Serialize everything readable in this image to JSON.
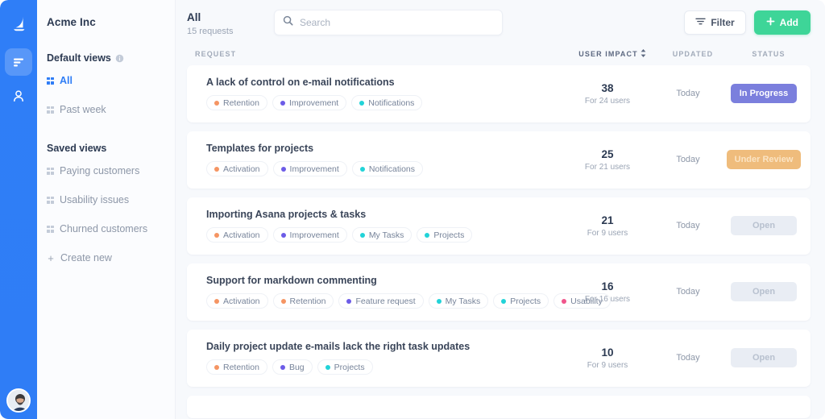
{
  "rail": {
    "logo_icon": "sail-logo-icon",
    "items": [
      {
        "icon": "feedback-bars-icon",
        "name": "rail-item-feedback",
        "active": true
      },
      {
        "icon": "user-icon",
        "name": "rail-item-users",
        "active": false
      }
    ],
    "avatar_icon": "user-avatar",
    "accent": "#2f7df6"
  },
  "sidebar": {
    "org_name": "Acme Inc",
    "groups": [
      {
        "title": "Default views",
        "has_info_icon": true,
        "items": [
          {
            "label": "All",
            "icon": "grid-icon",
            "active": true
          },
          {
            "label": "Past week",
            "icon": "grid-icon",
            "active": false
          }
        ]
      },
      {
        "title": "Saved views",
        "has_info_icon": false,
        "items": [
          {
            "label": "Paying customers",
            "icon": "grid-icon",
            "active": false
          },
          {
            "label": "Usability issues",
            "icon": "grid-icon",
            "active": false
          },
          {
            "label": "Churned customers",
            "icon": "grid-icon",
            "active": false
          },
          {
            "label": "Create new",
            "icon": "plus-icon",
            "active": false
          }
        ]
      }
    ]
  },
  "header": {
    "view_title": "All",
    "view_count": "15 requests",
    "search": {
      "placeholder": "Search",
      "value": "",
      "icon": "search-icon"
    },
    "filter_label": "Filter",
    "add_label": "Add",
    "add_color": "#3ed598"
  },
  "table": {
    "columns": {
      "request": "REQUEST",
      "user_impact": "USER IMPACT",
      "sort_icon": "sort-arrows-icon",
      "updated": "UPDATED",
      "status": "STATUS"
    },
    "tag_colors": {
      "Retention": "#f59563",
      "Activation": "#f59563",
      "Improvement": "#6c5ce7",
      "Feature request": "#6c5ce7",
      "Bug": "#6c5ce7",
      "Notifications": "#22d3d8",
      "My Tasks": "#22d3d8",
      "Projects": "#22d3d8",
      "Usability": "#f0558c"
    },
    "status_colors": {
      "In Progress": "#7b7fdd",
      "Under Review": "#efbc7c",
      "Open": "#e9edf4"
    },
    "rows": [
      {
        "title": "A lack of control on e-mail notifications",
        "tags": [
          "Retention",
          "Improvement",
          "Notifications"
        ],
        "impact": "38",
        "impact_sub": "For 24 users",
        "updated": "Today",
        "status": "In Progress",
        "status_class": "in-progress"
      },
      {
        "title": "Templates for projects",
        "tags": [
          "Activation",
          "Improvement",
          "Notifications"
        ],
        "impact": "25",
        "impact_sub": "For 21 users",
        "updated": "Today",
        "status": "Under Review",
        "status_class": "under-review"
      },
      {
        "title": "Importing Asana projects & tasks",
        "tags": [
          "Activation",
          "Improvement",
          "My Tasks",
          "Projects"
        ],
        "impact": "21",
        "impact_sub": "For 9 users",
        "updated": "Today",
        "status": "Open",
        "status_class": "open"
      },
      {
        "title": "Support for markdown commenting",
        "tags": [
          "Activation",
          "Retention",
          "Feature request",
          "My Tasks",
          "Projects",
          "Usability"
        ],
        "impact": "16",
        "impact_sub": "For 16 users",
        "updated": "Today",
        "status": "Open",
        "status_class": "open"
      },
      {
        "title": "Daily project update e-mails lack the right task updates",
        "tags": [
          "Retention",
          "Bug",
          "Projects"
        ],
        "impact": "10",
        "impact_sub": "For 9 users",
        "updated": "Today",
        "status": "Open",
        "status_class": "open"
      }
    ]
  }
}
